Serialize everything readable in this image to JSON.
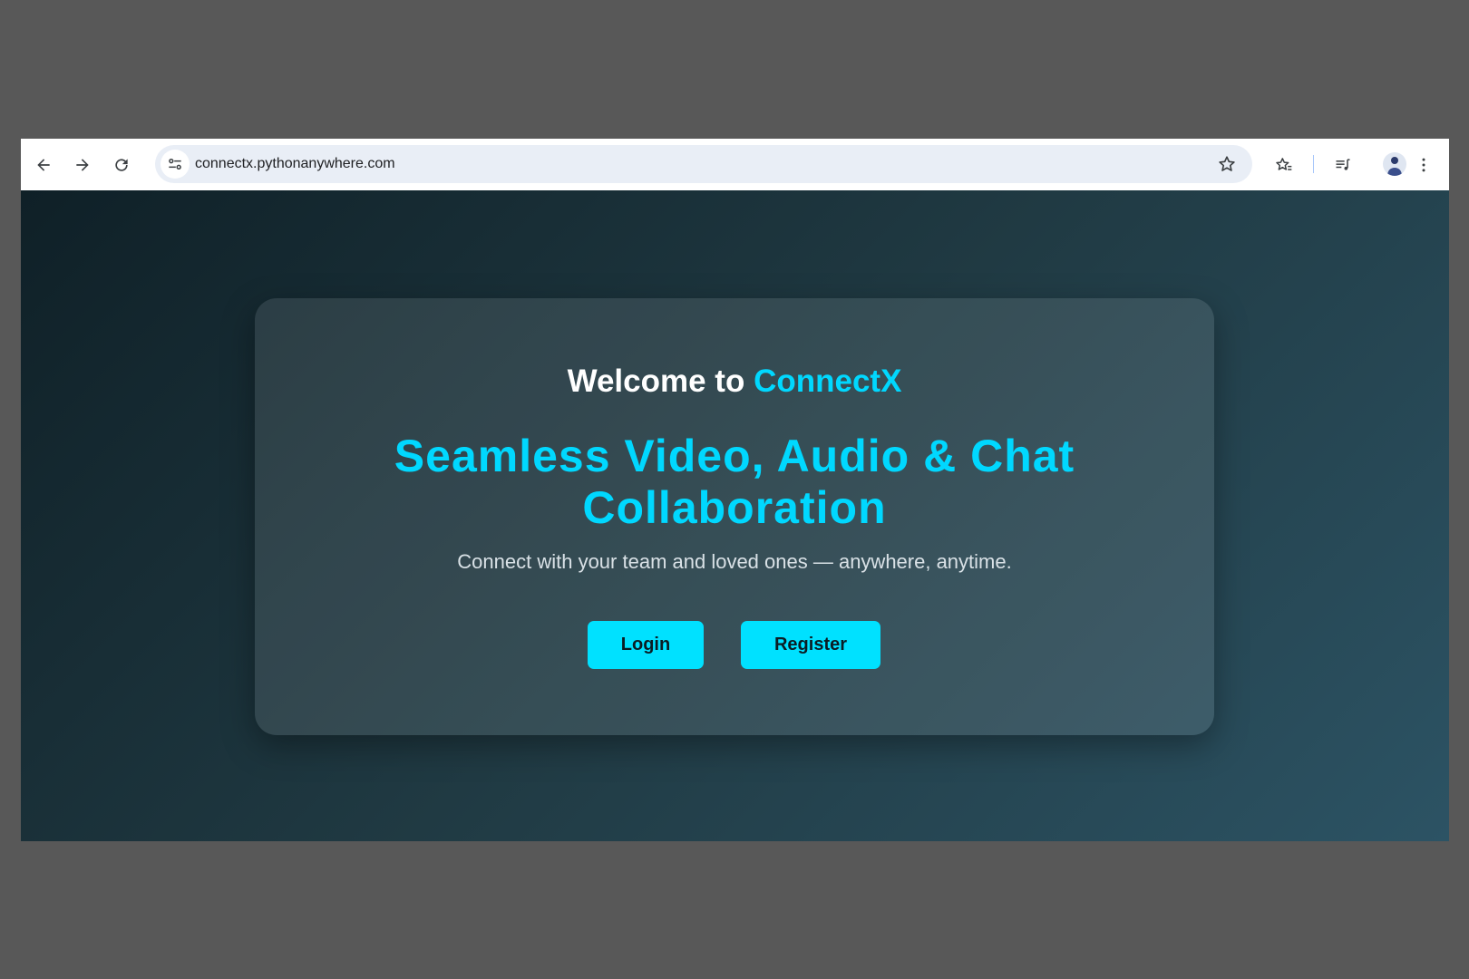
{
  "browser": {
    "url": "connectx.pythonanywhere.com",
    "icons": {
      "back": "back-arrow-icon",
      "forward": "forward-arrow-icon",
      "reload": "reload-icon",
      "site_info": "tune-icon",
      "bookmark": "star-icon",
      "bookmarks_manager": "star-list-icon",
      "media": "media-control-icon",
      "profile": "avatar",
      "menu": "kebab-menu-icon"
    }
  },
  "page": {
    "welcome_prefix": "Welcome to",
    "brand": "ConnectX",
    "tagline": "Seamless Video, Audio & Chat Collaboration",
    "subtitle": "Connect with your team and loved ones — anywhere, anytime.",
    "login_label": "Login",
    "register_label": "Register",
    "colors": {
      "accent": "#00d8ff",
      "button_bg": "#00e1ff",
      "gradient_start": "#0f2027",
      "gradient_end": "#2c5364"
    }
  }
}
